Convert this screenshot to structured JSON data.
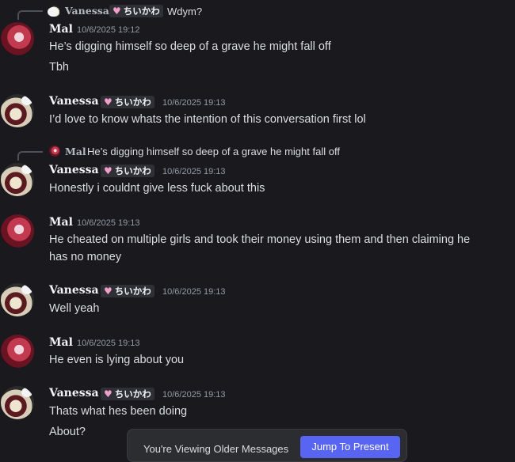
{
  "messages": [
    {
      "reply": {
        "name": "Vanessa",
        "tag": "ちいかわ",
        "text": "Wdym?"
      },
      "author": "Mal",
      "time": "10/6/2025 19:12",
      "lines": [
        "He’s digging himself so deep of a grave he might fall off",
        "Tbh"
      ]
    },
    {
      "author": "Vanessa",
      "tag": "ちいかわ",
      "time": "10/6/2025 19:13",
      "lines": [
        "I’d love to know whats the intention of this conversation first lol"
      ]
    },
    {
      "reply": {
        "name": "Mal",
        "text": "He’s digging himself so deep of a grave he might fall off"
      },
      "author": "Vanessa",
      "tag": "ちいかわ",
      "time": "10/6/2025 19:13",
      "lines": [
        "Honestly i couldnt give less fuck about this"
      ]
    },
    {
      "author": "Mal",
      "time": "10/6/2025 19:13",
      "lines": [
        "He cheated on multiple girls and took their money using them and then claiming he",
        "has no money"
      ]
    },
    {
      "author": "Vanessa",
      "tag": "ちいかわ",
      "time": "10/6/2025 19:13",
      "lines": [
        "Well yeah"
      ]
    },
    {
      "author": "Mal",
      "time": "10/6/2025 19:13",
      "lines": [
        "He even is lying about you"
      ]
    },
    {
      "author": "Vanessa",
      "tag": "ちいかわ",
      "time": "10/6/2025 19:13",
      "lines": [
        "Thats what hes been doing",
        "About?"
      ]
    }
  ],
  "bottom_bar": {
    "label": "You're Viewing Older Messages",
    "jump_label": "Jump To Present"
  },
  "icons": {
    "heart": "♥"
  },
  "colors": {
    "background": "#1a1a1e",
    "accent": "#5865f2",
    "heart": "#f19ecb"
  }
}
